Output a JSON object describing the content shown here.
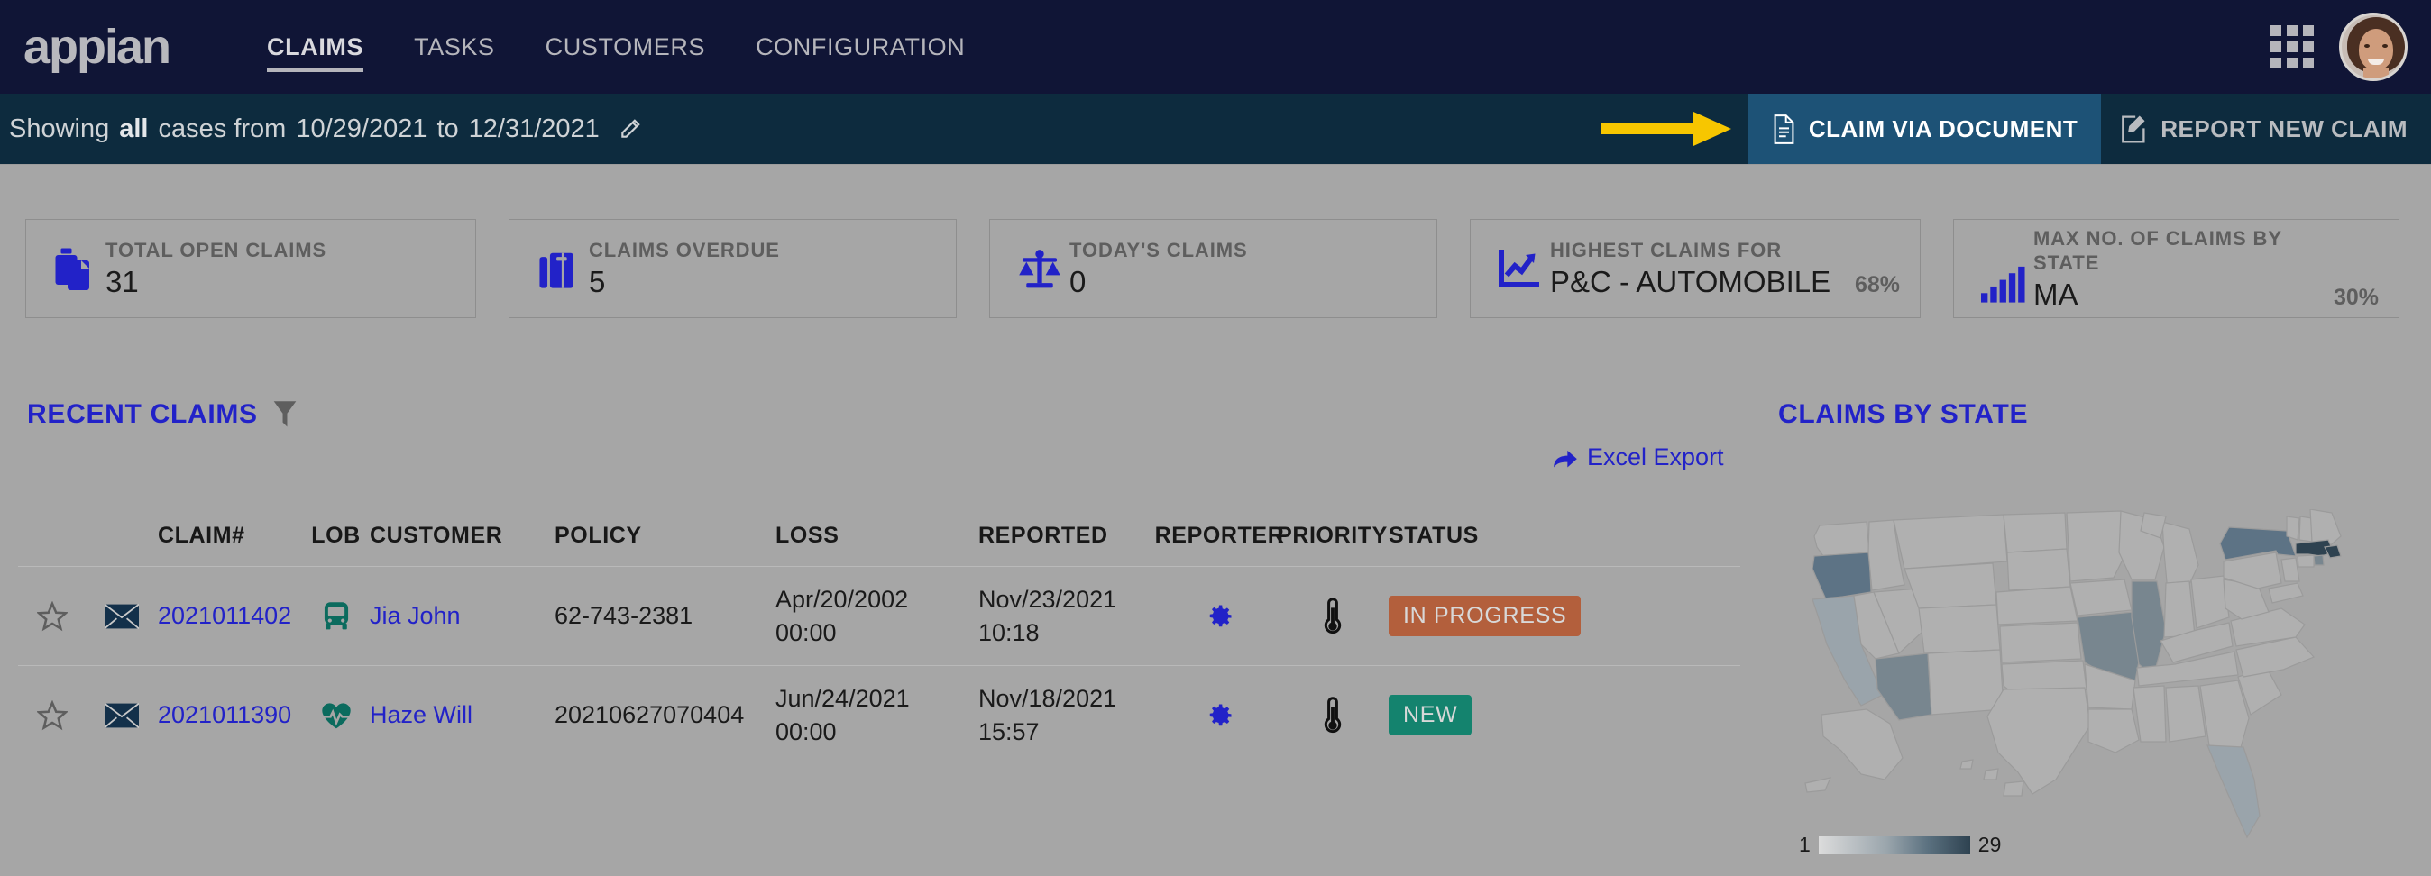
{
  "brand": {
    "logo_text": "appian",
    "accent": "#2222c8",
    "nav_bg": "#101536",
    "filter_bg": "#0d2b3e"
  },
  "topnav": {
    "items": [
      {
        "label": "CLAIMS",
        "active": true
      },
      {
        "label": "TASKS",
        "active": false
      },
      {
        "label": "CUSTOMERS",
        "active": false
      },
      {
        "label": "CONFIGURATION",
        "active": false
      }
    ],
    "apps_icon": "grid-apps-icon",
    "avatar": "user-avatar"
  },
  "filterbar": {
    "prefix": "Showing",
    "scope": "all",
    "middle": "cases from",
    "date_from": "10/29/2021",
    "to": "to",
    "date_to": "12/31/2021",
    "edit_icon": "pencil-icon",
    "arrow_icon": "yellow-arrow-icon",
    "claim_via_document": "CLAIM VIA DOCUMENT",
    "report_new_claim": "REPORT NEW CLAIM",
    "doc_icon": "document-icon",
    "report_icon": "edit-document-icon"
  },
  "kpis": [
    {
      "label": "TOTAL OPEN CLAIMS",
      "value": "31",
      "pct": "",
      "icon": "briefcase-copy-icon"
    },
    {
      "label": "CLAIMS OVERDUE",
      "value": "5",
      "pct": "",
      "icon": "briefcase-icon"
    },
    {
      "label": "TODAY'S CLAIMS",
      "value": "0",
      "pct": "",
      "icon": "scales-icon"
    },
    {
      "label": "HIGHEST CLAIMS FOR",
      "value": "P&C - AUTOMOBILE",
      "pct": "68%",
      "icon": "line-chart-icon"
    },
    {
      "label": "MAX NO. OF CLAIMS BY STATE",
      "value": "MA",
      "pct": "30%",
      "icon": "bar-chart-icon"
    }
  ],
  "recent_claims": {
    "title": "RECENT CLAIMS",
    "filter_icon": "funnel-icon",
    "excel_export": "Excel Export",
    "excel_icon": "share-arrow-icon",
    "columns": [
      "",
      "",
      "CLAIM#",
      "LOB",
      "CUSTOMER",
      "POLICY",
      "LOSS",
      "REPORTED",
      "REPORTER",
      "PRIORITY",
      "STATUS"
    ],
    "rows": [
      {
        "star": "star-outline-icon",
        "mail": "envelope-icon",
        "claim": "2021011402",
        "lob_icon": "bus-icon",
        "customer": "Jia John",
        "policy": "62-743-2381",
        "loss_date": "Apr/20/2002",
        "loss_time": "00:00",
        "reported_date": "Nov/23/2021",
        "reported_time": "10:18",
        "reporter_icon": "gear-icon",
        "priority_icon": "thermometer-icon",
        "status": "IN PROGRESS",
        "status_color": "#b35f3c"
      },
      {
        "star": "star-outline-icon",
        "mail": "envelope-icon",
        "claim": "2021011390",
        "lob_icon": "heartbeat-icon",
        "customer": "Haze Will",
        "policy": "20210627070404",
        "loss_date": "Jun/24/2021",
        "loss_time": "00:00",
        "reported_date": "Nov/18/2021",
        "reported_time": "15:57",
        "reporter_icon": "gear-icon",
        "priority_icon": "thermometer-icon",
        "status": "NEW",
        "status_color": "#14836e"
      }
    ]
  },
  "claims_by_state": {
    "title": "CLAIMS BY STATE",
    "legend_min": "1",
    "legend_max": "29",
    "highlighted_states": [
      {
        "code": "MA",
        "level": "max"
      },
      {
        "code": "NY",
        "level": "high"
      },
      {
        "code": "OR",
        "level": "high"
      },
      {
        "code": "IL",
        "level": "mid"
      },
      {
        "code": "MO",
        "level": "mid"
      },
      {
        "code": "AZ",
        "level": "mid"
      },
      {
        "code": "CA",
        "level": "low"
      },
      {
        "code": "FL",
        "level": "low"
      },
      {
        "code": "RI",
        "level": "mid"
      }
    ]
  }
}
